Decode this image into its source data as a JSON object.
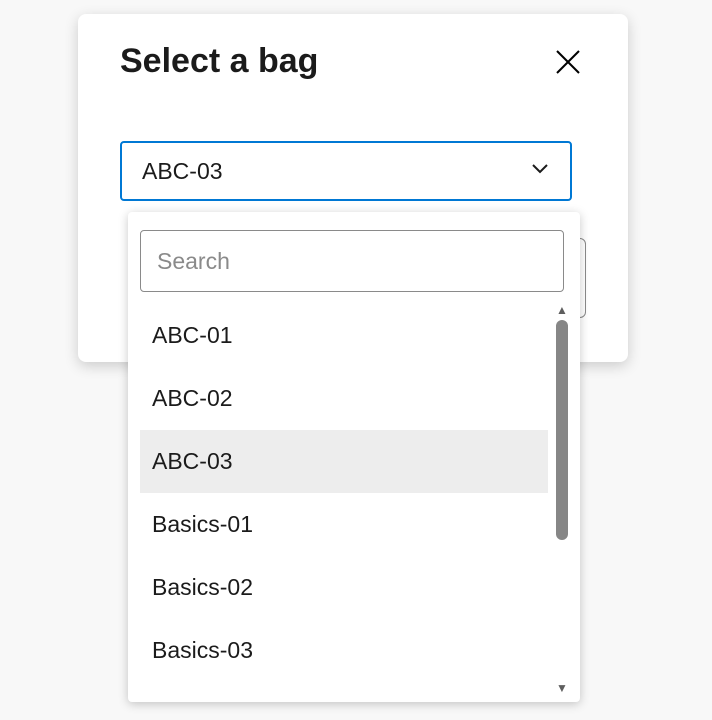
{
  "dialog": {
    "title": "Select a bag"
  },
  "select": {
    "value": "ABC-03"
  },
  "search": {
    "placeholder": "Search",
    "value": ""
  },
  "options": [
    {
      "label": "ABC-01",
      "selected": false
    },
    {
      "label": "ABC-02",
      "selected": false
    },
    {
      "label": "ABC-03",
      "selected": true
    },
    {
      "label": "Basics-01",
      "selected": false
    },
    {
      "label": "Basics-02",
      "selected": false
    },
    {
      "label": "Basics-03",
      "selected": false
    }
  ]
}
